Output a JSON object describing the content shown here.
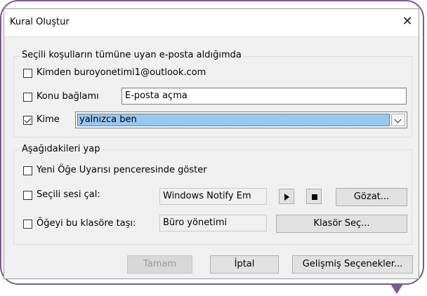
{
  "window": {
    "title": "Kural Oluştur",
    "close_glyph": "✕"
  },
  "conditions": {
    "legend": "Seçili koşulların tümüne uyan e-posta aldığımda",
    "from": {
      "label": "Kimden buroyonetimi1@outlook.com",
      "checked": false
    },
    "subject": {
      "label": "Konu bağlamı",
      "checked": false,
      "value": "E-posta açma"
    },
    "to": {
      "label": "Kime",
      "checked": true,
      "selected": "yalnızca ben"
    }
  },
  "actions": {
    "legend": "Aşağıdakileri yap",
    "alert": {
      "label": "Yeni Öğe Uyarısı penceresinde göster",
      "checked": false
    },
    "sound": {
      "label": "Seçili sesi çal:",
      "checked": false,
      "value": "Windows Notify Em",
      "browse_label": "Gözat..."
    },
    "move": {
      "label": "Öğeyi bu klasöre taşı:",
      "checked": false,
      "value": "Büro yönetimi",
      "folder_button": "Klasör Seç..."
    }
  },
  "footer": {
    "ok": "Tamam",
    "cancel": "İptal",
    "advanced": "Gelişmiş Seçenekler..."
  },
  "colors": {
    "frame": "#7a5a96",
    "selection": "#99c9ef"
  }
}
